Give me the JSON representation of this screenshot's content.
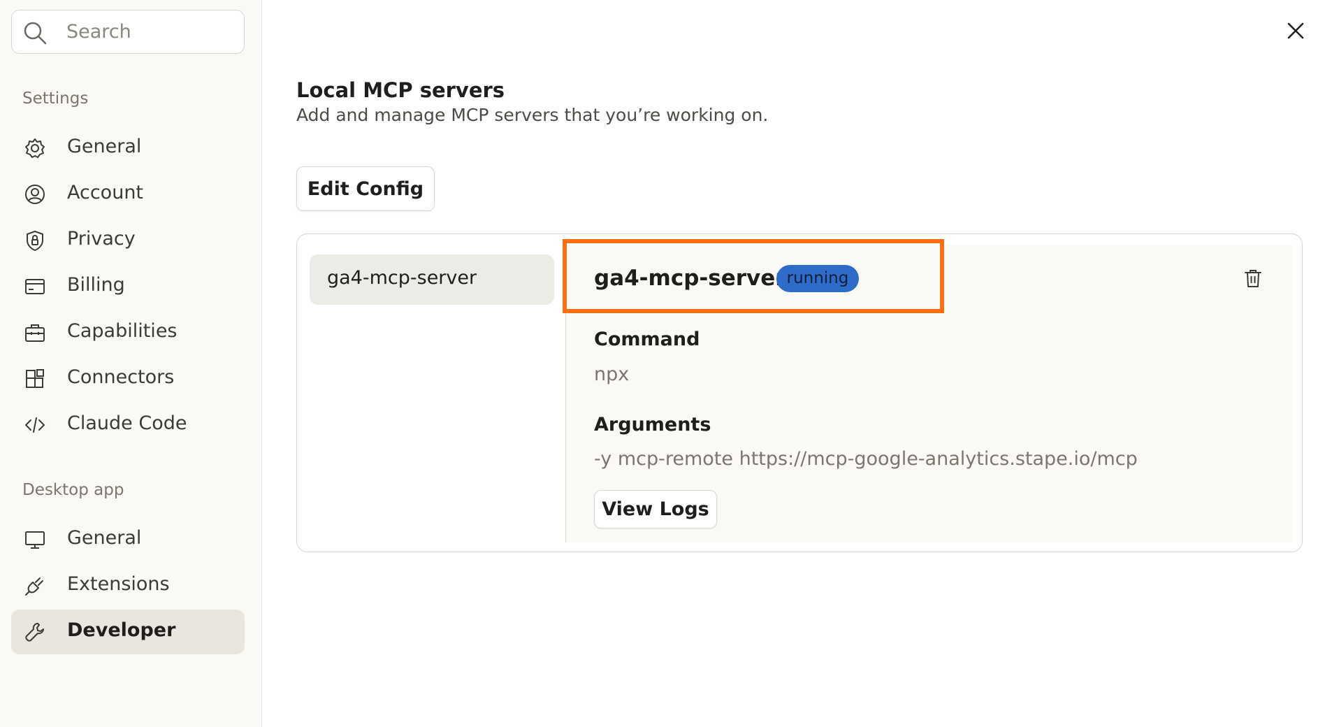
{
  "search": {
    "placeholder": "Search"
  },
  "sidebar": {
    "settings_label": "Settings",
    "settings_items": [
      {
        "label": "General",
        "icon": "gear-icon"
      },
      {
        "label": "Account",
        "icon": "user-circle-icon"
      },
      {
        "label": "Privacy",
        "icon": "shield-lock-icon"
      },
      {
        "label": "Billing",
        "icon": "credit-card-icon"
      },
      {
        "label": "Capabilities",
        "icon": "toolbox-icon"
      },
      {
        "label": "Connectors",
        "icon": "blocks-icon"
      },
      {
        "label": "Claude Code",
        "icon": "code-icon"
      }
    ],
    "desktop_label": "Desktop app",
    "desktop_items": [
      {
        "label": "General",
        "icon": "monitor-icon"
      },
      {
        "label": "Extensions",
        "icon": "plug-icon"
      },
      {
        "label": "Developer",
        "icon": "wrench-icon",
        "active": true
      }
    ]
  },
  "main": {
    "title": "Local MCP servers",
    "subtitle": "Add and manage MCP servers that you’re working on.",
    "edit_config_label": "Edit Config",
    "servers": [
      {
        "name": "ga4-mcp-server"
      }
    ],
    "detail": {
      "name": "ga4-mcp-server",
      "status": "running",
      "command_label": "Command",
      "command_value": "npx",
      "arguments_label": "Arguments",
      "arguments_value": "-y mcp-remote https://mcp-google-analytics.stape.io/mcp",
      "view_logs_label": "View Logs"
    }
  },
  "colors": {
    "highlight": "#ff6f0f",
    "badge": "#2f6bc9",
    "active_nav": "#e8e6df"
  }
}
